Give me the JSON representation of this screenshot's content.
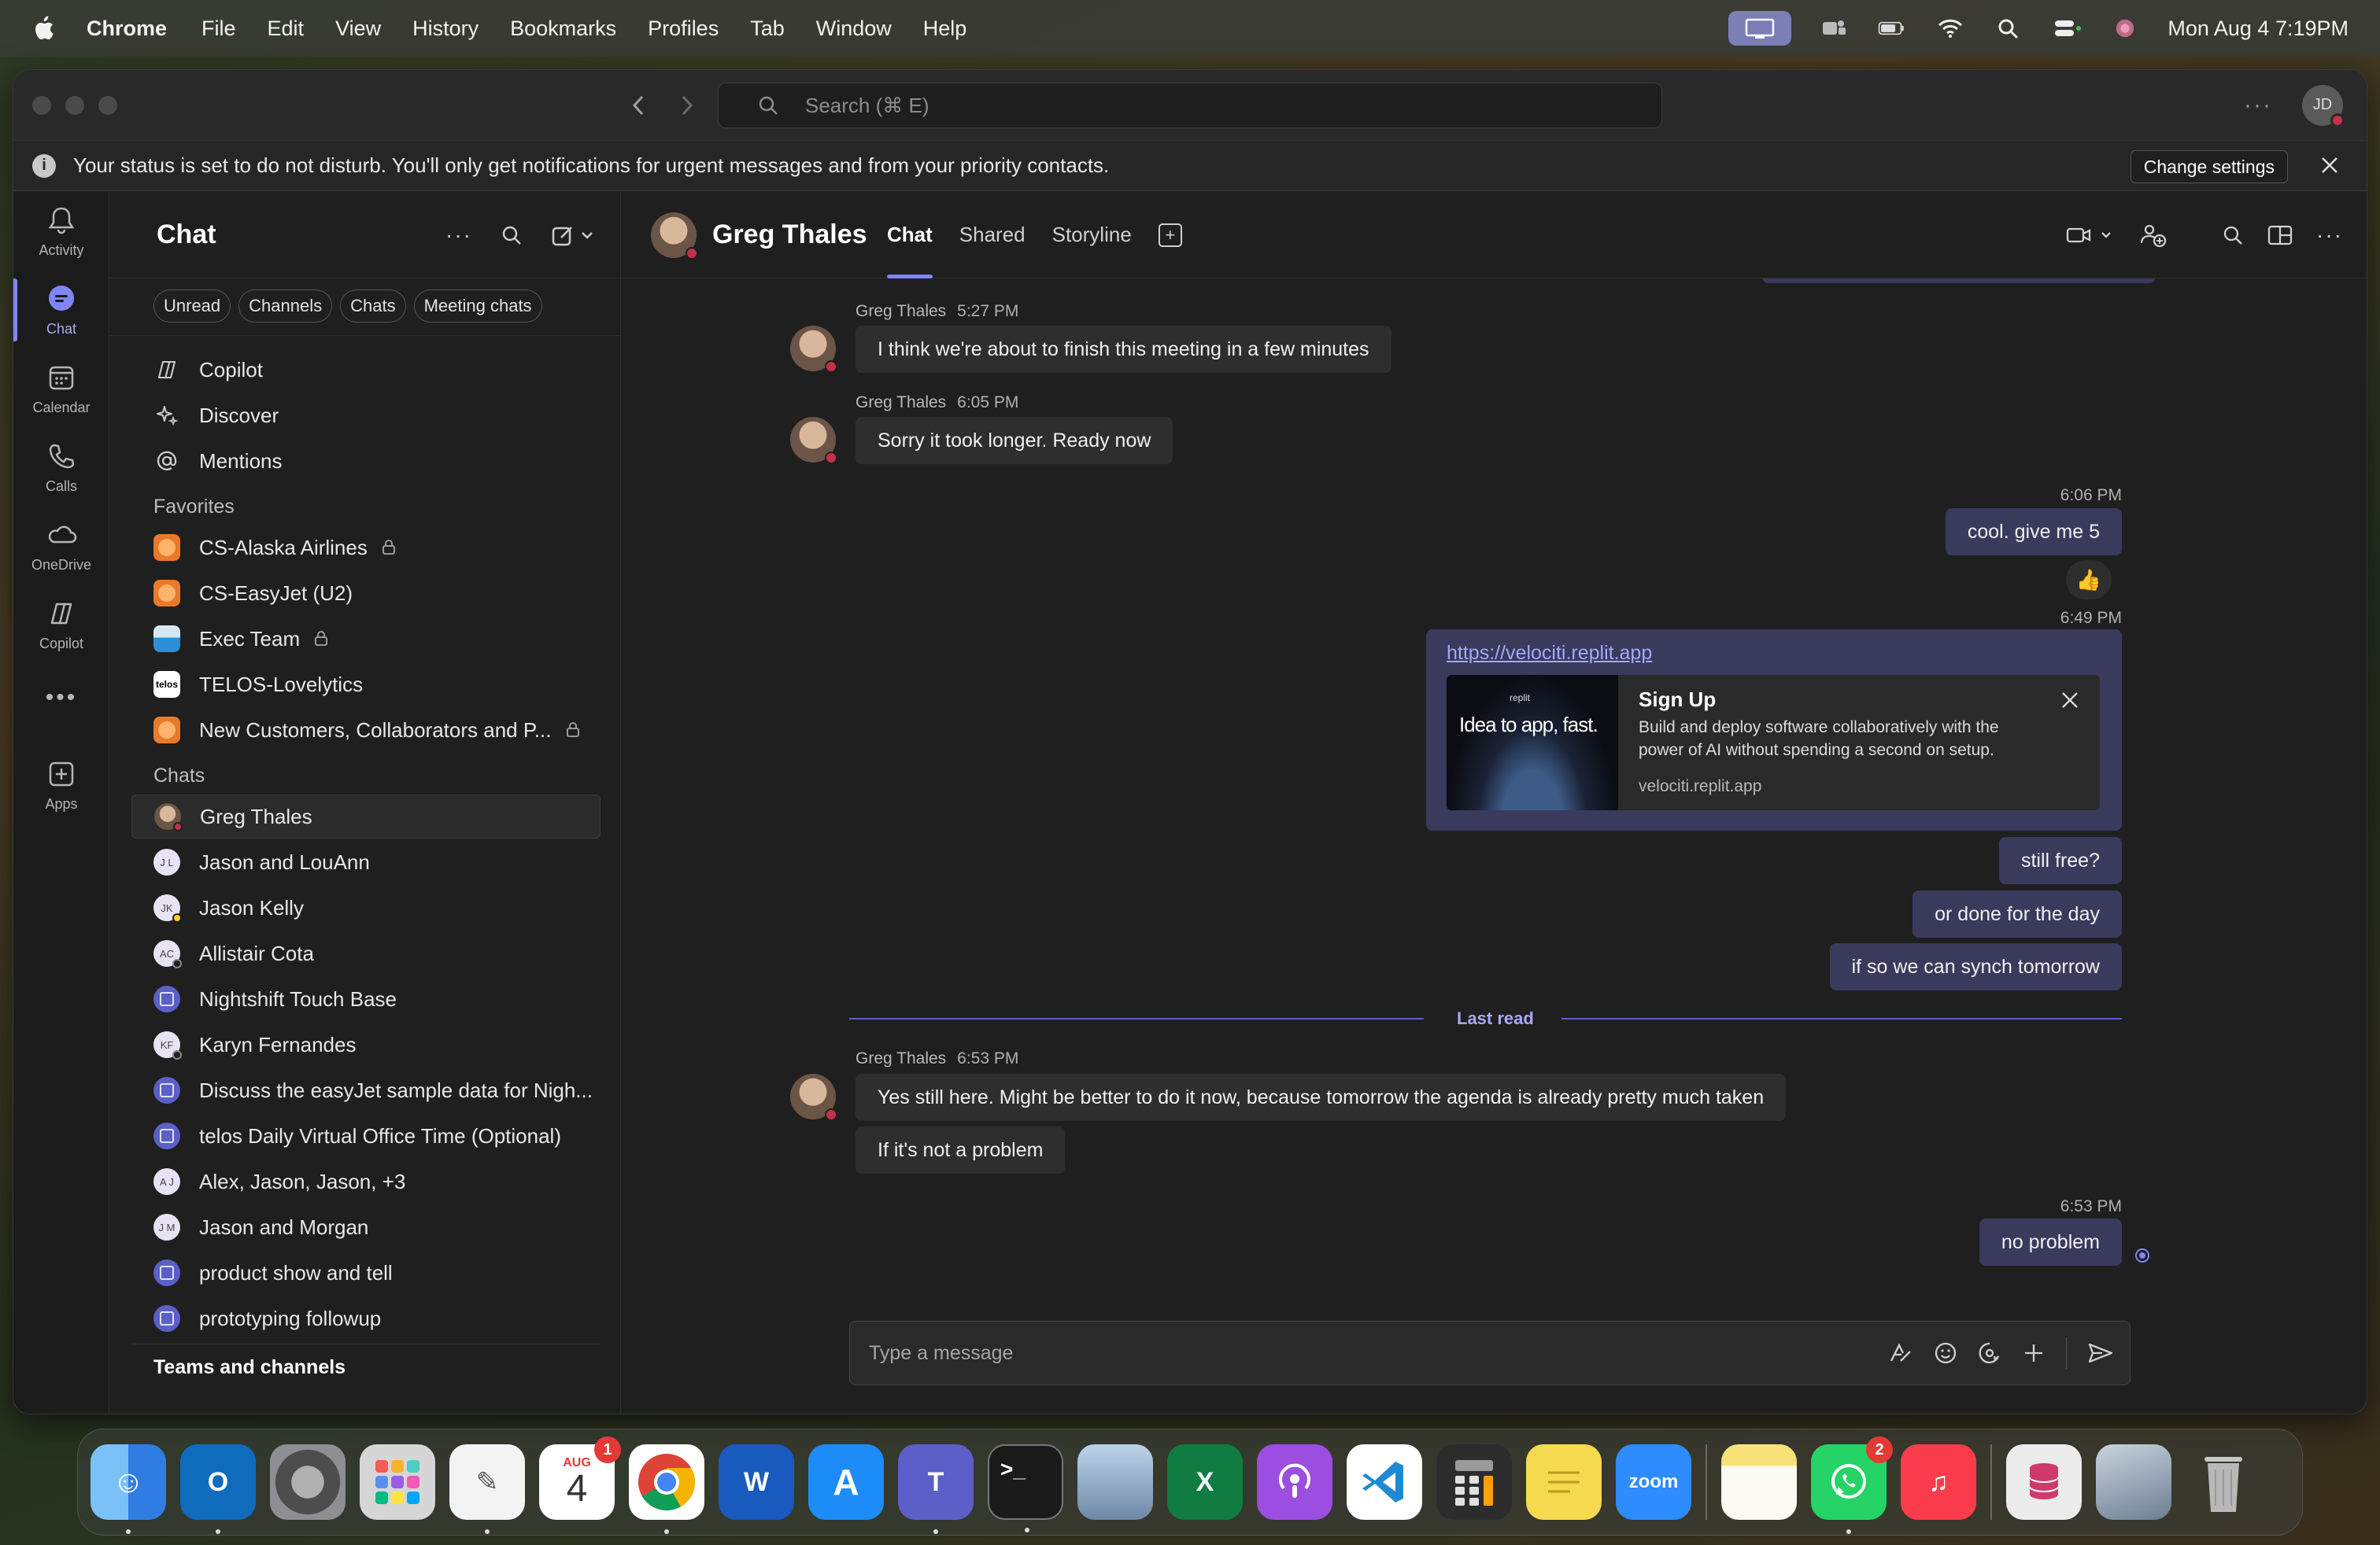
{
  "menubar": {
    "app_name": "Chrome",
    "items": [
      "File",
      "Edit",
      "View",
      "History",
      "Bookmarks",
      "Profiles",
      "Tab",
      "Window",
      "Help"
    ],
    "datetime": "Mon Aug 4  7:19PM"
  },
  "titlebar": {
    "search_placeholder": "Search (⌘ E)",
    "avatar_initials": "JD"
  },
  "banner": {
    "message": "Your status is set to do not disturb. You'll only get notifications for urgent messages and from your priority contacts.",
    "button": "Change settings"
  },
  "rail": {
    "items": [
      {
        "label": "Activity",
        "icon": "bell-icon"
      },
      {
        "label": "Chat",
        "icon": "chat-icon",
        "active": true
      },
      {
        "label": "Calendar",
        "icon": "calendar-icon"
      },
      {
        "label": "Calls",
        "icon": "phone-icon"
      },
      {
        "label": "OneDrive",
        "icon": "cloud-icon"
      },
      {
        "label": "Copilot",
        "icon": "copilot-icon"
      },
      {
        "label": "Apps",
        "icon": "apps-icon"
      }
    ]
  },
  "sidebar": {
    "title": "Chat",
    "filters": [
      "Unread",
      "Channels",
      "Chats",
      "Meeting chats"
    ],
    "quick": [
      "Copilot",
      "Discover",
      "Mentions"
    ],
    "favorites_title": "Favorites",
    "favorites": [
      "CS-Alaska Airlines",
      "CS-EasyJet (U2)",
      "Exec Team",
      "TELOS-Lovelytics",
      "New Customers, Collaborators and P..."
    ],
    "chats_title": "Chats",
    "chats": [
      "Greg Thales",
      "Jason and LouAnn",
      "Jason Kelly",
      "Allistair Cota",
      "Nightshift Touch Base",
      "Karyn Fernandes",
      "Discuss the easyJet sample data for Nigh...",
      "telos Daily Virtual Office Time (Optional)",
      "Alex, Jason, Jason, +3",
      "Jason and Morgan",
      "product show and tell",
      "prototyping followup"
    ],
    "avatar_initials": {
      "jason_louann": "J L",
      "jason_kelly": "JK",
      "allistair": "AC",
      "karyn": "KF",
      "alex": "A J",
      "jason_morgan": "J M"
    },
    "teams_title": "Teams and channels"
  },
  "chat": {
    "name": "Greg Thales",
    "tabs": [
      "Chat",
      "Shared",
      "Storyline"
    ],
    "messages": {
      "m1_sender": "Greg Thales",
      "m1_time": "5:27 PM",
      "m1_text": "I think we're about to finish this meeting in a few minutes",
      "m2_sender": "Greg Thales",
      "m2_time": "6:05 PM",
      "m2_text": "Sorry it took longer. Ready now",
      "m3_time": "6:06 PM",
      "m3_text": "cool. give me 5",
      "m3_reaction": "👍",
      "m4_time": "6:49 PM",
      "link_url": "https://velociti.replit.app",
      "preview_brand": "replit",
      "preview_tagline": "Idea to app, fast.",
      "preview_title": "Sign Up",
      "preview_desc": "Build and deploy software collaboratively with the power of AI without spending a second on setup.",
      "preview_domain": "velociti.replit.app",
      "m5_text": "still free?",
      "m6_text": "or done for the day",
      "m7_text": "if so we can synch tomorrow",
      "last_read": "Last read",
      "m8_sender": "Greg Thales",
      "m8_time": "6:53 PM",
      "m8_text": "Yes still here. Might be better to do it now, because tomorrow the agenda is already pretty much taken",
      "m9_text": "If it's not a problem",
      "m10_time": "6:53 PM",
      "m10_text": "no problem"
    },
    "composer_placeholder": "Type a message"
  },
  "dock": {
    "apps": [
      {
        "name": "Finder",
        "color": "#3c8ef0"
      },
      {
        "name": "Outlook",
        "color": "#0f6cbd"
      },
      {
        "name": "System Settings",
        "color": "#8e8e93"
      },
      {
        "name": "Launchpad",
        "color": "#d0d0d0"
      },
      {
        "name": "TextEdit",
        "color": "#f2f2f2"
      },
      {
        "name": "Calendar",
        "color": "#ffffff"
      },
      {
        "name": "Chrome",
        "color": "#ffffff"
      },
      {
        "name": "Word",
        "color": "#185abd"
      },
      {
        "name": "App Store",
        "color": "#1e8cf8"
      },
      {
        "name": "Teams",
        "color": "#5b5fc7"
      },
      {
        "name": "Terminal",
        "color": "#1a1a1a"
      },
      {
        "name": "Preview",
        "color": "#9fb3c8"
      },
      {
        "name": "Excel",
        "color": "#107c41"
      },
      {
        "name": "Podcasts",
        "color": "#9b4ee0"
      },
      {
        "name": "VS Code",
        "color": "#ffffff"
      },
      {
        "name": "Calculator",
        "color": "#2c2c2c"
      },
      {
        "name": "Stickies",
        "color": "#f5d94e"
      },
      {
        "name": "Zoom",
        "color": "#2d8cff"
      },
      {
        "name": "Notes",
        "color": "#f7e27a"
      },
      {
        "name": "WhatsApp",
        "color": "#25d366"
      },
      {
        "name": "Music",
        "color": "#fa3c4c"
      },
      {
        "name": "Database",
        "color": "#e8e8e8"
      },
      {
        "name": "Photo",
        "color": "#8a9ab0"
      },
      {
        "name": "Trash",
        "color": "#9a9a9a"
      }
    ],
    "calendar_month": "AUG",
    "calendar_day": "4",
    "calendar_badge": "1",
    "whatsapp_badge": "2",
    "zoom_label": "zoom"
  }
}
